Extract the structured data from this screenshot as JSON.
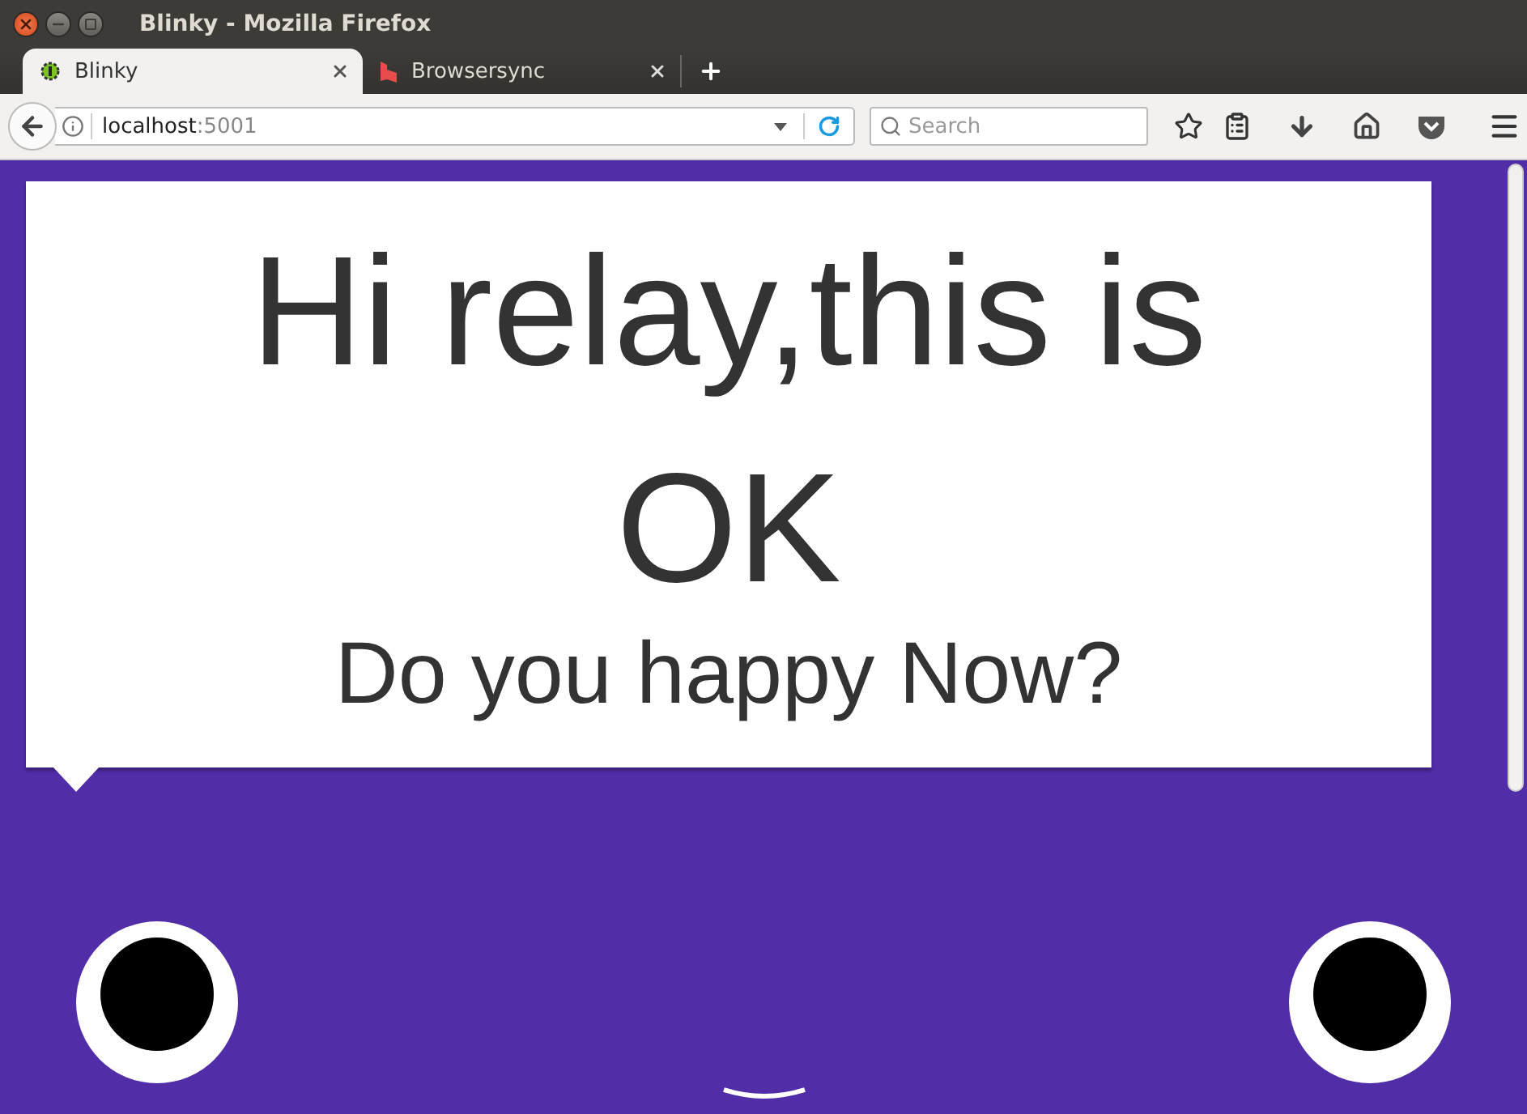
{
  "window": {
    "title": "Blinky - Mozilla Firefox"
  },
  "tabs": [
    {
      "label": "Blinky",
      "selected": true
    },
    {
      "label": "Browsersync",
      "selected": false
    }
  ],
  "address": {
    "host": "localhost",
    "port": ":5001"
  },
  "search": {
    "placeholder": "Search"
  },
  "bubble": {
    "heading": "Hi relay,this is OK",
    "subheading": "Do you happy Now?"
  }
}
